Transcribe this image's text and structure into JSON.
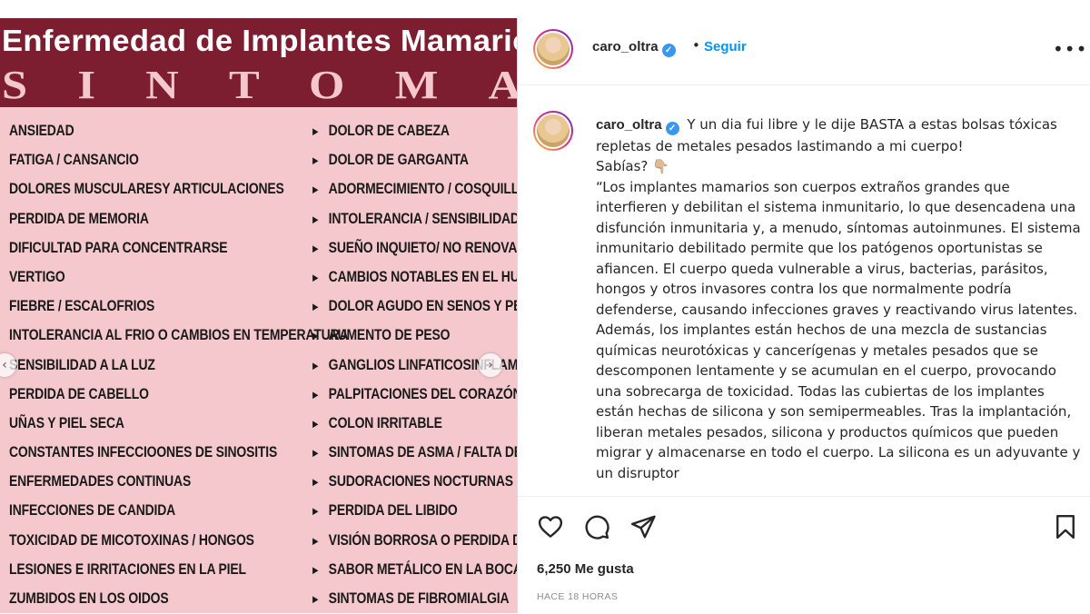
{
  "image": {
    "title": "Enfermedad de Implantes Mamarios",
    "subtitle": "SINTOMAS",
    "left_symptoms": [
      "ANSIEDAD",
      "FATIGA / CANSANCIO",
      "DOLORES MUSCULARESY ARTICULACIONES",
      "PERDIDA DE MEMORIA",
      "DIFICULTAD PARA CONCENTRARSE",
      "VERTIGO",
      "FIEBRE / ESCALOFRIOS",
      "INTOLERANCIA AL FRIO O CAMBIOS EN TEMPERATURA",
      "SENSIBILIDAD A LA LUZ",
      "PERDIDA DE CABELLO",
      "UÑAS Y PIEL SECA",
      "CONSTANTES INFECCIOONES DE SINOSITIS",
      "ENFERMEDADES CONTINUAS",
      "INFECCIONES DE CANDIDA",
      "TOXICIDAD DE MICOTOXINAS / HONGOS",
      "LESIONES E IRRITACIONES EN LA PIEL",
      "ZUMBIDOS EN LOS OIDOS"
    ],
    "right_symptoms": [
      "DOLOR DE CABEZA",
      "DOLOR DE GARGANTA",
      "ADORMECIMIENTO / COSQUILLEO",
      "INTOLERANCIA / SENSIBILIDAD A Q",
      "SUEÑO INQUIETO/ NO RENOVADO",
      "CAMBIOS NOTABLES EN EL HUMOR",
      "DOLOR AGUDO EN SENOS Y PECHO",
      "AUMENTO DE PESO",
      "GANGLIOS LINFATICOSINFLAMADO",
      "PALPITACIONES DEL CORAZÓN",
      "COLON IRRITABLE",
      "SINTOMAS DE ASMA / FALTA DE AI",
      "SUDORACIONES NOCTURNAS",
      "PERDIDA DEL LIBIDO",
      "VISIÓN BORROSA O PERDIDA DE LA",
      "SABOR METÁLICO EN LA BOCA",
      "SINTOMAS DE FIBROMIALGIA"
    ],
    "bullet": "►",
    "prev_icon": "chevron-left-icon",
    "next_icon": "chevron-right-icon"
  },
  "header": {
    "username": "caro_oltra",
    "separator": "•",
    "follow_label": "Seguir",
    "more_icon": "more-horizontal-icon"
  },
  "caption": {
    "username": "caro_oltra",
    "paragraphs": [
      "Y un dia fui libre y le dije BASTA a estas bolsas tóxicas repletas de metales pesados lastimando a mi cuerpo!",
      "Sabías? 👇🏼",
      "“Los implantes mamarios son cuerpos extraños grandes que interfieren y debilitan el sistema inmunitario, lo que desencadena una disfunción inmunitaria y, a menudo, síntomas autoinmunes. El sistema inmunitario debilitado permite que los patógenos oportunistas se afiancen. El cuerpo queda vulnerable a virus, bacterias, parásitos, hongos y otros invasores contra los que normalmente podría defenderse, causando infecciones graves y reactivando virus latentes. Además, los implantes están hechos de una mezcla de sustancias químicas neurotóxicas y cancerígenas y metales pesados que se descomponen lentamente y se acumulan en el cuerpo, provocando una sobrecarga de toxicidad. Todas las cubiertas de los implantes están hechas de silicona y son semipermeables. Tras la implantación, liberan metales pesados, silicona y productos químicos que pueden migrar y almacenarse en todo el cuerpo. La silicona es un adyuvante y un disruptor"
    ]
  },
  "actions": {
    "like_icon": "heart-icon",
    "comment_icon": "comment-icon",
    "share_icon": "send-icon",
    "save_icon": "bookmark-icon",
    "likes_text": "6,250 Me gusta",
    "time_ago": "HACE 18 HORAS"
  },
  "colors": {
    "banner": "#7d1e30",
    "image_bg": "#f4c8cc",
    "link_blue": "#0095f6",
    "verified_blue": "#3897f0"
  }
}
